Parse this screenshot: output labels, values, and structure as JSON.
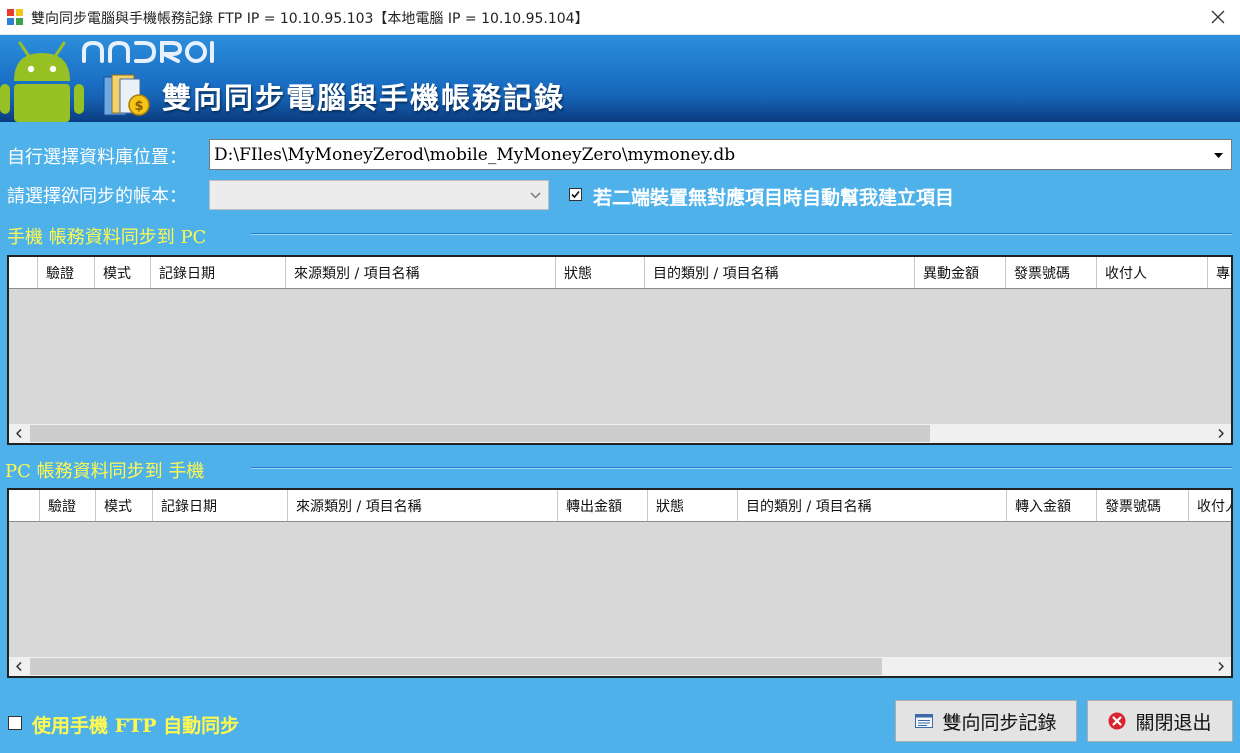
{
  "window": {
    "title": "雙向同步電腦與手機帳務記錄 FTP IP = 10.10.95.103【本地電腦 IP = 10.10.95.104】"
  },
  "banner": {
    "logo_text": "ANDROID",
    "title": "雙向同步電腦與手機帳務記錄"
  },
  "settings": {
    "db_label": "自行選擇資料庫位置：",
    "db_path": "D:\\FIles\\MyMoneyZerod\\mobile_MyMoneyZero\\mymoney.db",
    "account_label": "請選擇欲同步的帳本：",
    "account_value": "",
    "auto_create_label": "若二端裝置無對應項目時自動幫我建立項目",
    "auto_create_checked": true
  },
  "section_mobile_to_pc": {
    "title": "手機 帳務資料同步到 PC",
    "columns": [
      "",
      "驗證",
      "模式",
      "記錄日期",
      "來源類別 / 項目名稱",
      "狀態",
      "目的類別 / 項目名稱",
      "異動金額",
      "發票號碼",
      "收付人",
      "專"
    ],
    "rows": []
  },
  "section_pc_to_mobile": {
    "title": "PC 帳務資料同步到 手機",
    "columns": [
      "",
      "驗證",
      "模式",
      "記錄日期",
      "來源類別 / 項目名稱",
      "轉出金額",
      "狀態",
      "目的類別 / 項目名稱",
      "轉入金額",
      "發票號碼",
      "收付人"
    ],
    "rows": []
  },
  "footer": {
    "ftp_auto_sync_label": "使用手機 FTP 自動同步",
    "ftp_auto_sync_checked": false,
    "sync_button_label": "雙向同步記錄",
    "close_button_label": "關閉退出"
  },
  "colors": {
    "background": "#4fb1ea",
    "banner_dark": "#0f4d99",
    "section_title": "#fff94f",
    "android_green": "#97c024"
  }
}
